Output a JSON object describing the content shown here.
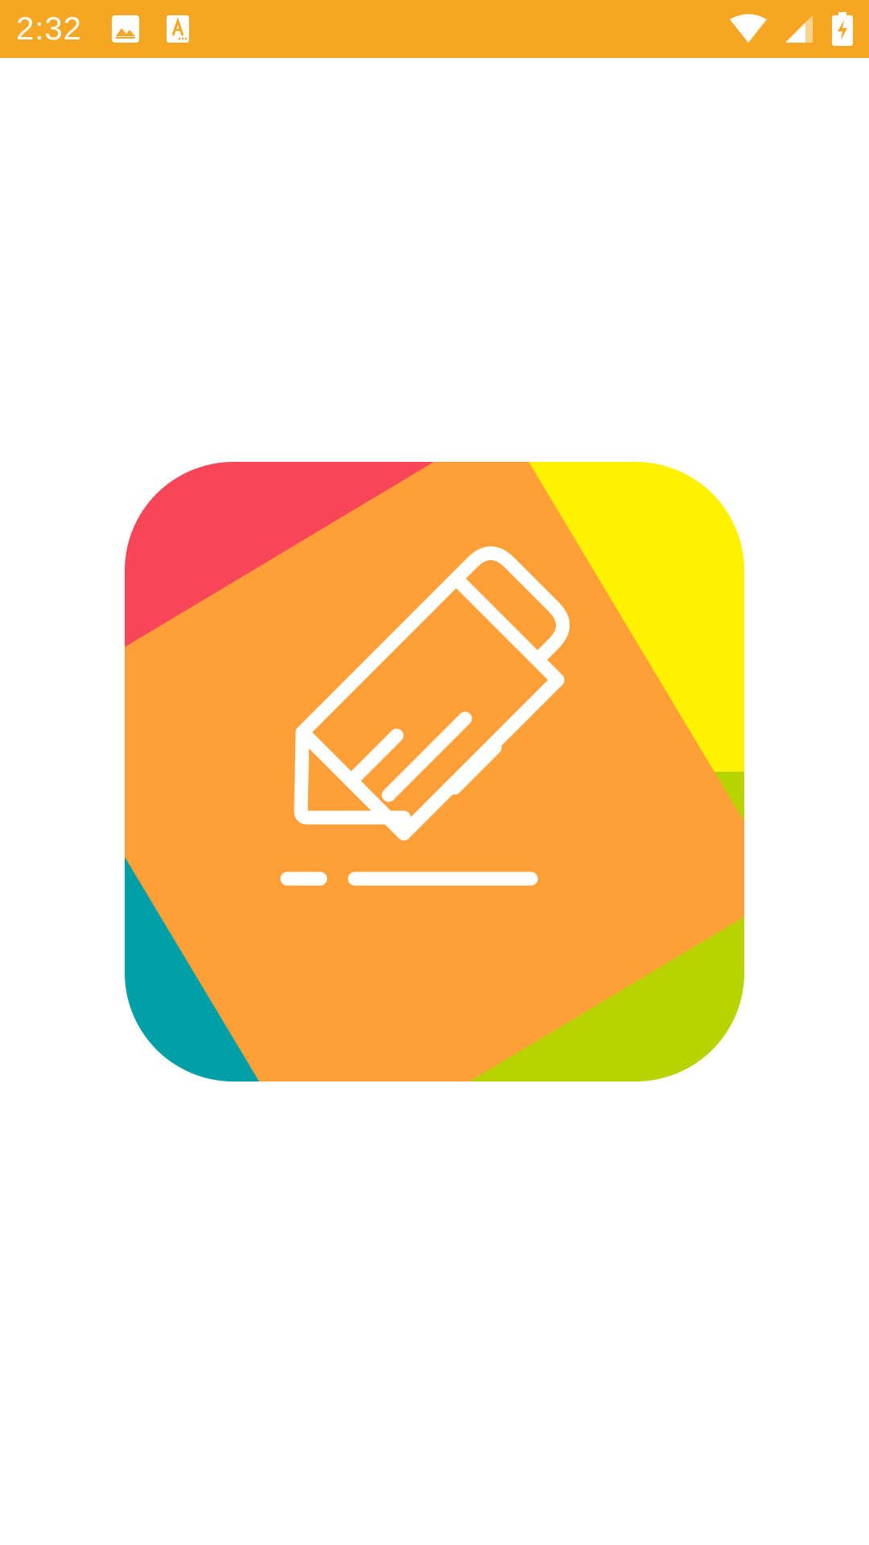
{
  "status_bar": {
    "time": "2:32",
    "background_color": "#f5a623",
    "left_icons": [
      "image-notification-icon",
      "font-download-notification-icon"
    ],
    "right_icons": [
      "wifi-icon",
      "cell-signal-icon",
      "battery-charging-icon"
    ]
  },
  "splash": {
    "background_color": "#ffffff",
    "logo": {
      "icon": "pencil-note-icon",
      "colors": {
        "top_left": "#f74657",
        "top_right": "#fff200",
        "bottom_left": "#01a0a8",
        "bottom_right": "#b9d300",
        "center": "#fe9f38",
        "glyph": "#ffffff"
      }
    }
  }
}
